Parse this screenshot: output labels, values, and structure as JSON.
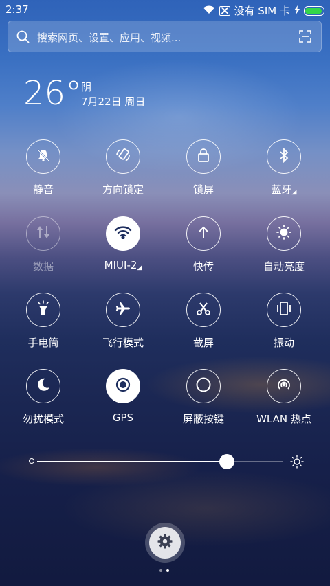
{
  "status_bar": {
    "time": "2:37",
    "carrier": "没有 SIM 卡",
    "icons": [
      "wifi-icon",
      "no-sim-icon",
      "charging-icon",
      "battery-icon"
    ],
    "battery_level": 1.0,
    "battery_color": "#34d64a"
  },
  "search": {
    "placeholder": "搜索网页、设置、应用、视频..."
  },
  "weather": {
    "temperature": "26°",
    "condition": "阴",
    "date": "7月22日 周日"
  },
  "toggles": [
    {
      "label": "静音",
      "icon": "mute-bell-icon",
      "state": "off"
    },
    {
      "label": "方向锁定",
      "icon": "rotation-lock-icon",
      "state": "off"
    },
    {
      "label": "锁屏",
      "icon": "lock-icon",
      "state": "off"
    },
    {
      "label": "蓝牙",
      "icon": "bluetooth-icon",
      "state": "off",
      "has_more": true
    },
    {
      "label": "数据",
      "icon": "mobile-data-icon",
      "state": "disabled"
    },
    {
      "label": "MIUI-2",
      "icon": "wifi-icon",
      "state": "on",
      "has_more": true
    },
    {
      "label": "快传",
      "icon": "upload-arrow-icon",
      "state": "off"
    },
    {
      "label": "自动亮度",
      "icon": "auto-brightness-icon",
      "state": "off"
    },
    {
      "label": "手电筒",
      "icon": "flashlight-icon",
      "state": "off"
    },
    {
      "label": "飞行模式",
      "icon": "airplane-icon",
      "state": "off"
    },
    {
      "label": "截屏",
      "icon": "scissors-icon",
      "state": "off"
    },
    {
      "label": "振动",
      "icon": "vibrate-icon",
      "state": "off"
    },
    {
      "label": "勿扰模式",
      "icon": "moon-icon",
      "state": "off"
    },
    {
      "label": "GPS",
      "icon": "gps-icon",
      "state": "on"
    },
    {
      "label": "屏蔽按键",
      "icon": "block-keys-icon",
      "state": "off"
    },
    {
      "label": "WLAN 热点",
      "icon": "hotspot-icon",
      "state": "off"
    }
  ],
  "brightness": {
    "level": 0.77,
    "icons": [
      "brightness-low-icon",
      "brightness-high-icon"
    ]
  },
  "settings_button": {
    "icon": "gear-icon"
  },
  "pager": {
    "pages": 2,
    "current": 2
  }
}
